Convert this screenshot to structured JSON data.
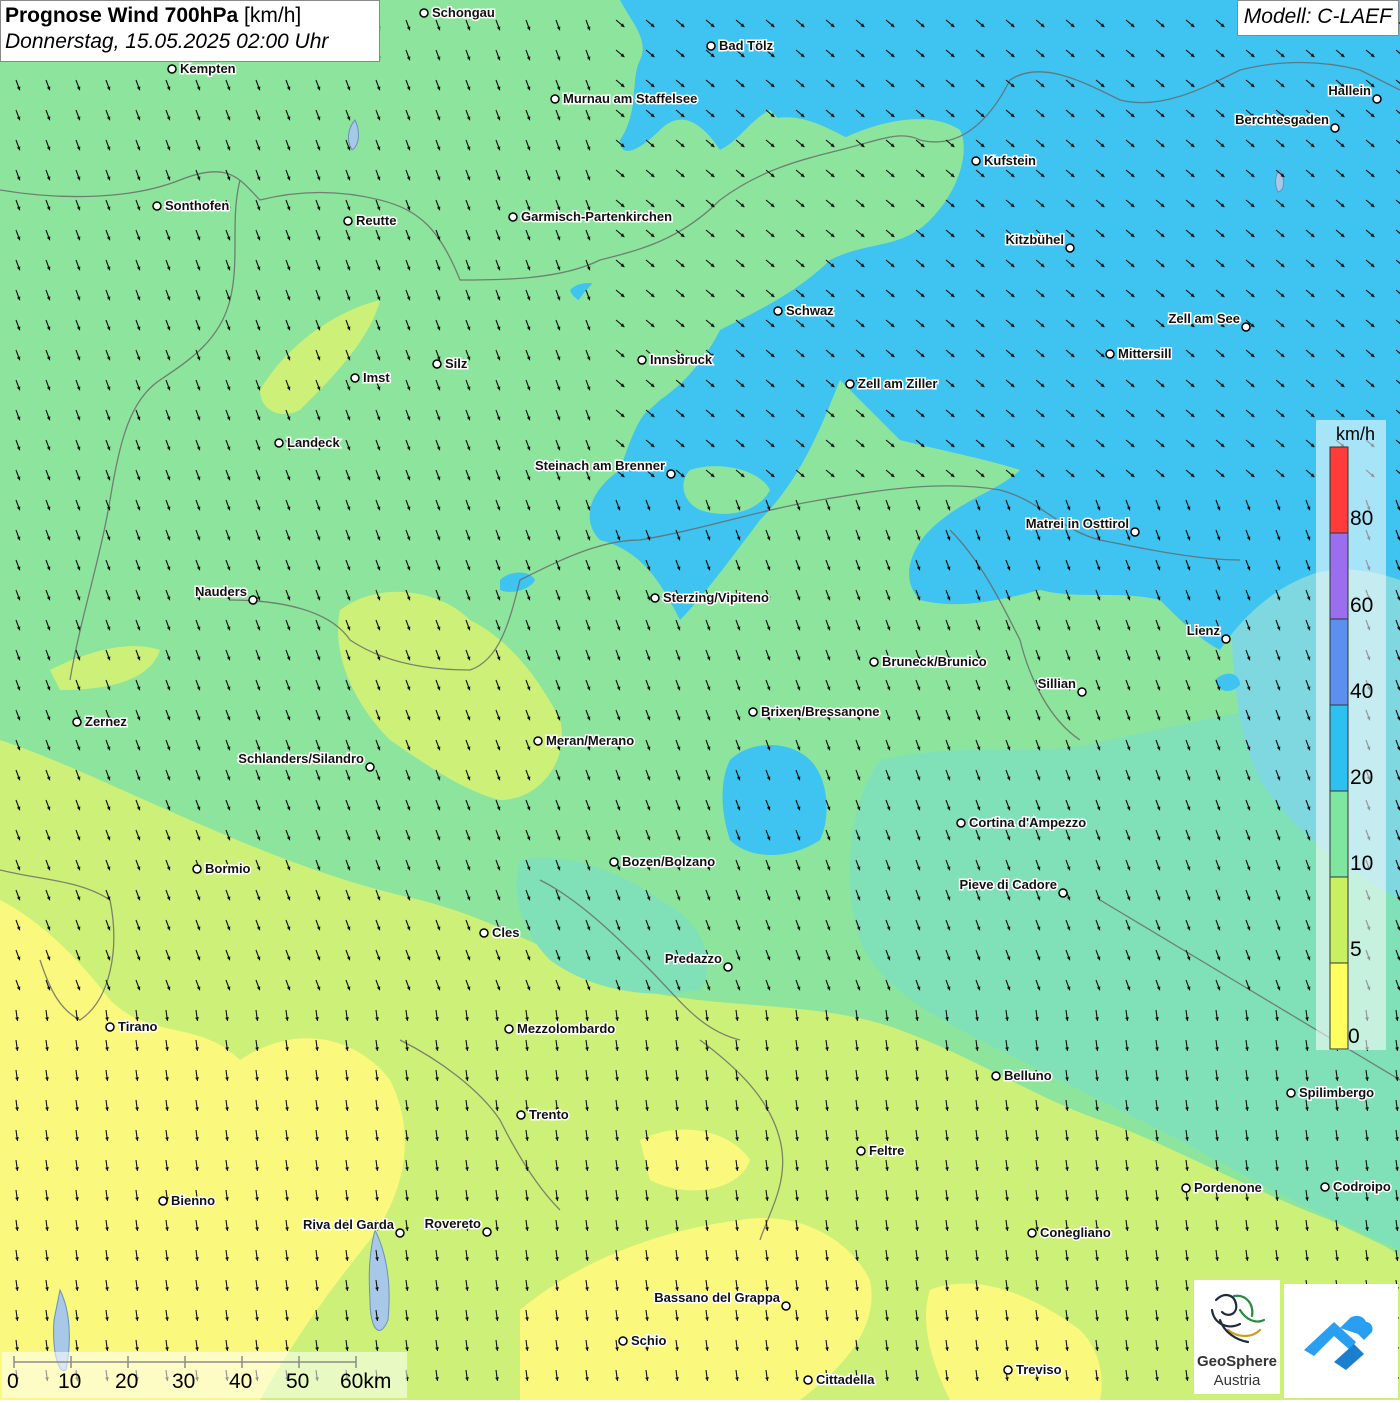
{
  "title": {
    "main": "Prognose Wind 700hPa",
    "unit": "[km/h]",
    "date": "Donnerstag, 15.05.2025 02:00 Uhr"
  },
  "model": "Modell: C-LAEF",
  "legend": {
    "unit": "km/h",
    "labels": [
      "80",
      "60",
      "40",
      "20",
      "10",
      "5",
      "0"
    ],
    "colors": [
      "#ff3b3b",
      "#9b6ef0",
      "#5b8ff0",
      "#2ec0f0",
      "#7fe6a0",
      "#c8f060",
      "#ffff60"
    ]
  },
  "colors": {
    "yellow": "#fbf87e",
    "yellow_green": "#cdf178",
    "green": "#8de59d",
    "teal": "#80e0b8",
    "cyan": "#7fd8e0",
    "blue": "#3fc3f0"
  },
  "cities": [
    {
      "name": "Schongau"
    },
    {
      "name": "Bad Tölz"
    },
    {
      "name": "Kempten"
    },
    {
      "name": "Murnau am Staffelsee"
    },
    {
      "name": "Hallein"
    },
    {
      "name": "Berchtesgaden"
    },
    {
      "name": "Kufstein"
    },
    {
      "name": "Sonthofen"
    },
    {
      "name": "Reutte"
    },
    {
      "name": "Garmisch-Partenkirchen"
    },
    {
      "name": "Kitzbühel"
    },
    {
      "name": "Schwaz"
    },
    {
      "name": "Zell am See"
    },
    {
      "name": "Mittersill"
    },
    {
      "name": "Innsbruck"
    },
    {
      "name": "Silz"
    },
    {
      "name": "Imst"
    },
    {
      "name": "Zell am Ziller"
    },
    {
      "name": "Landeck"
    },
    {
      "name": "Steinach am Brenner"
    },
    {
      "name": "Matrei in Osttirol"
    },
    {
      "name": "Nauders"
    },
    {
      "name": "Sterzing/Vipiteno"
    },
    {
      "name": "Lienz"
    },
    {
      "name": "Bruneck/Brunico"
    },
    {
      "name": "Sillian"
    },
    {
      "name": "Zernez"
    },
    {
      "name": "Brixen/Bressanone"
    },
    {
      "name": "Meran/Merano"
    },
    {
      "name": "Schlanders/Silandro"
    },
    {
      "name": "Cortina d'Ampezzo"
    },
    {
      "name": "Bormio"
    },
    {
      "name": "Bozen/Bolzano"
    },
    {
      "name": "Pieve di Cadore"
    },
    {
      "name": "Cles"
    },
    {
      "name": "Predazzo"
    },
    {
      "name": "Tirano"
    },
    {
      "name": "Mezzolombardo"
    },
    {
      "name": "Belluno"
    },
    {
      "name": "Spilimbergo"
    },
    {
      "name": "Trento"
    },
    {
      "name": "Feltre"
    },
    {
      "name": "Bienno"
    },
    {
      "name": "Pordenone"
    },
    {
      "name": "Codroipo"
    },
    {
      "name": "Riva del Garda"
    },
    {
      "name": "Rovereto"
    },
    {
      "name": "Conegliano"
    },
    {
      "name": "Bassano del Grappa"
    },
    {
      "name": "Schio"
    },
    {
      "name": "Treviso"
    },
    {
      "name": "Cittadella"
    }
  ],
  "scale": {
    "labels": [
      "0",
      "10",
      "20",
      "30",
      "40",
      "50",
      "60km"
    ]
  },
  "logo": {
    "line1": "GeoSphere",
    "line2": "Austria"
  }
}
